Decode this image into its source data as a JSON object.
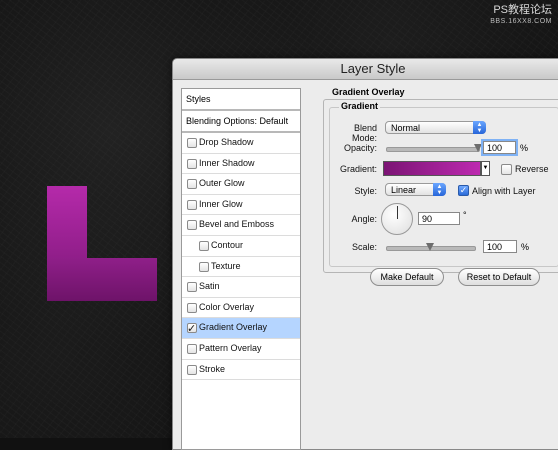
{
  "watermark": {
    "line1": "PS教程论坛",
    "line2": "BBS.16XX8.COM"
  },
  "dialog": {
    "title": "Layer Style"
  },
  "left_panel": {
    "header": "Styles",
    "blending": "Blending Options: Default",
    "items": [
      {
        "label": "Drop Shadow",
        "checked": false,
        "indent": false
      },
      {
        "label": "Inner Shadow",
        "checked": false,
        "indent": false
      },
      {
        "label": "Outer Glow",
        "checked": false,
        "indent": false
      },
      {
        "label": "Inner Glow",
        "checked": false,
        "indent": false
      },
      {
        "label": "Bevel and Emboss",
        "checked": false,
        "indent": false
      },
      {
        "label": "Contour",
        "checked": false,
        "indent": true
      },
      {
        "label": "Texture",
        "checked": false,
        "indent": true
      },
      {
        "label": "Satin",
        "checked": false,
        "indent": false
      },
      {
        "label": "Color Overlay",
        "checked": false,
        "indent": false
      },
      {
        "label": "Gradient Overlay",
        "checked": true,
        "indent": false,
        "selected": true
      },
      {
        "label": "Pattern Overlay",
        "checked": false,
        "indent": false
      },
      {
        "label": "Stroke",
        "checked": false,
        "indent": false
      }
    ]
  },
  "gradient_overlay": {
    "group_title": "Gradient Overlay",
    "sub_title": "Gradient",
    "blend_mode": {
      "label": "Blend Mode:",
      "value": "Normal"
    },
    "opacity": {
      "label": "Opacity:",
      "value": "100",
      "unit": "%",
      "level": 1.0
    },
    "gradient": {
      "label": "Gradient:",
      "colors": [
        "#7b1474",
        "#bd2ab0"
      ]
    },
    "reverse": {
      "label": "Reverse",
      "checked": false
    },
    "style": {
      "label": "Style:",
      "value": "Linear"
    },
    "align": {
      "label": "Align with Layer",
      "checked": true
    },
    "angle": {
      "label": "Angle:",
      "value": "90",
      "unit": "°"
    },
    "scale": {
      "label": "Scale:",
      "value": "100",
      "unit": "%",
      "level": 0.5
    }
  },
  "buttons": {
    "make_default": "Make Default",
    "reset_default": "Reset to Default"
  },
  "colors": {
    "canvas": "#141414",
    "letter_top": "#b52aaa",
    "letter_bottom": "#6e1369",
    "selection": "#b5d5ff"
  }
}
